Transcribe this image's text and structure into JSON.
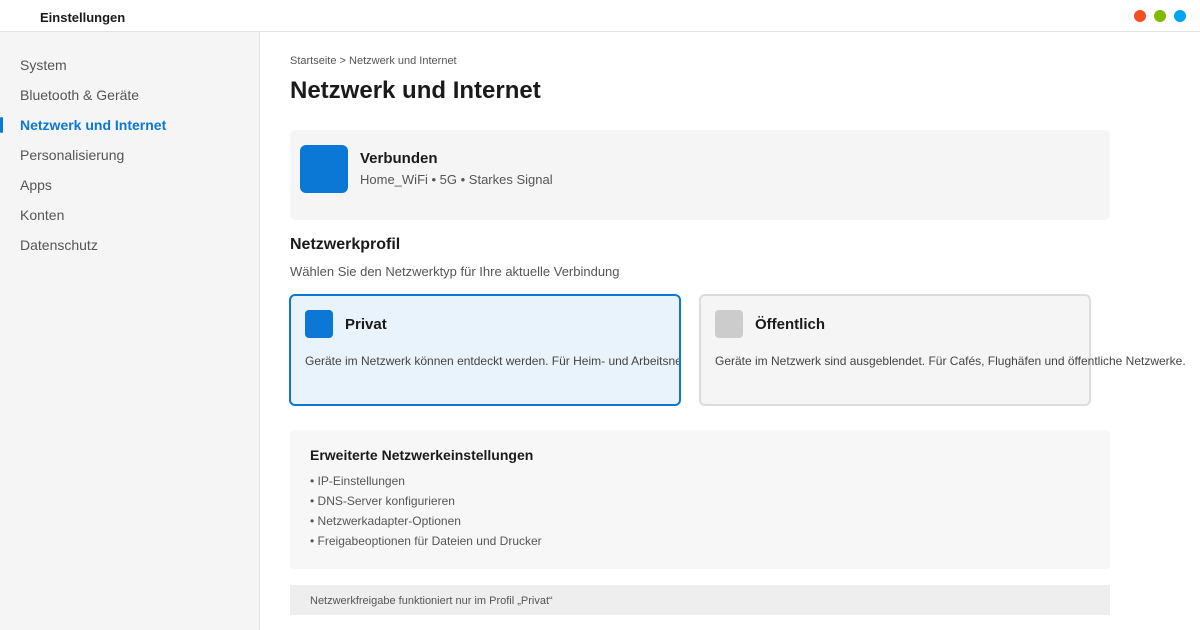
{
  "window": {
    "title": "Einstellungen",
    "controls": [
      {
        "name": "close",
        "color": "#f25022"
      },
      {
        "name": "maximize",
        "color": "#7fba00"
      },
      {
        "name": "minimize",
        "color": "#00a4ef"
      }
    ]
  },
  "sidebar": {
    "active_color": "#0a78d4",
    "items": [
      {
        "label": "System",
        "active": false
      },
      {
        "label": "Bluetooth & Geräte",
        "active": false
      },
      {
        "label": "Netzwerk und Internet",
        "active": true
      },
      {
        "label": "Personalisierung",
        "active": false
      },
      {
        "label": "Apps",
        "active": false
      },
      {
        "label": "Konten",
        "active": false
      },
      {
        "label": "Datenschutz",
        "active": false
      }
    ]
  },
  "main": {
    "breadcrumb": "Startseite > Netzwerk und Internet",
    "title": "Netzwerk und Internet",
    "connection": {
      "icon": "network-status-icon",
      "status": "Verbunden",
      "details": "Home_WiFi • 5G • Starkes Signal"
    },
    "profile_section": {
      "title": "Netzwerkprofil",
      "subtitle": "Wählen Sie den Netzwerktyp für Ihre aktuelle Verbindung",
      "options": [
        {
          "title": "Privat",
          "description": "Geräte im Netzwerk können entdeckt werden. Für Heim- und Arbeitsnetzwerke.",
          "selected": true
        },
        {
          "title": "Öffentlich",
          "description": "Geräte im Netzwerk sind ausgeblendet. Für Cafés, Flughäfen und öffentliche Netzwerke.",
          "selected": false
        }
      ]
    },
    "advanced": {
      "title": "Erweiterte Netzwerkeinstellungen",
      "items": [
        "• IP-Einstellungen",
        "• DNS-Server konfigurieren",
        "• Netzwerkadapter-Optionen",
        "• Freigabeoptionen für Dateien und Drucker"
      ]
    },
    "note": "Netzwerkfreigabe funktioniert nur im Profil „Privat“"
  }
}
